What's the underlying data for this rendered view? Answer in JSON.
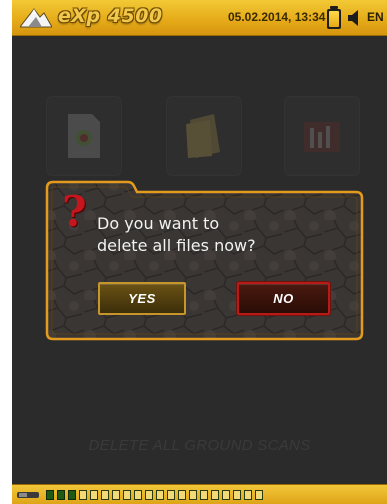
{
  "header": {
    "logo_text": "eXp 4500",
    "datetime": "05.02.2014, 13:34",
    "language": "EN",
    "battery_icon": "battery-icon",
    "sound_icon": "speaker-icon"
  },
  "background": {
    "menu_icons": [
      "file-icon",
      "papers-icon",
      "scan-graph-icon"
    ],
    "caption": "DELETE ALL GROUND SCANS"
  },
  "dialog": {
    "icon": "question-mark-icon",
    "message_line1": "Do you want to",
    "message_line2": "delete all files now?",
    "yes_label": "YES",
    "no_label": "NO",
    "selected": "NO"
  },
  "footer": {
    "signal_bars_total": 20,
    "signal_bars_active": 3
  },
  "colors": {
    "bar_yellow": "#e6ac1a",
    "dialog_border": "#e49b1d",
    "no_border": "#b81b16",
    "yes_border": "#c6962a",
    "question_red": "#c4161c"
  }
}
